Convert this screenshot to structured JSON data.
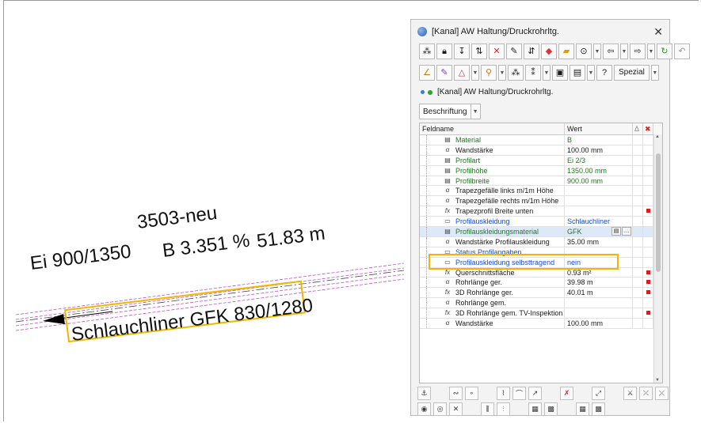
{
  "cad": {
    "name": "3503-neu",
    "dims": "Ei 900/1350",
    "slope": "B 3.351 %",
    "length": "51.83 m",
    "liner": "Schlauchliner GFK 830/1280",
    "highlight_color": "#f5b400",
    "hatch_color": "#c050c0"
  },
  "dialog": {
    "title": "[Kanal] AW Haltung/Druckrohrltg.",
    "close": "✕",
    "layer": "[Kanal] AW Haltung/Druckrohrltg.",
    "beschriftung": "Beschriftung",
    "spezial": "Spezial",
    "columns": {
      "name": "Feldname",
      "value": "Wert",
      "delta": "Δ",
      "x": "✖"
    },
    "rows": [
      {
        "icon": "book-icon",
        "glyph": "▤",
        "name": "Material",
        "value": "B",
        "style": "green",
        "red": false
      },
      {
        "icon": "alpha-icon",
        "glyph": "α",
        "name": "Wandstärke",
        "value": "100.00 mm",
        "style": "",
        "red": false
      },
      {
        "icon": "book-icon",
        "glyph": "▤",
        "name": "Profilart",
        "value": "Ei 2/3",
        "style": "green",
        "red": false
      },
      {
        "icon": "book-icon",
        "glyph": "▤",
        "name": "Profilhöhe",
        "value": "1350.00 mm",
        "style": "green",
        "red": false
      },
      {
        "icon": "book-icon",
        "glyph": "▤",
        "name": "Profilbreite",
        "value": "900.00 mm",
        "style": "green",
        "red": false
      },
      {
        "icon": "alpha-icon",
        "glyph": "α",
        "name": "Trapezgefälle links m/1m Höhe",
        "value": "",
        "style": "",
        "red": false
      },
      {
        "icon": "alpha-icon",
        "glyph": "α",
        "name": "Trapezgefälle rechts m/1m Höhe",
        "value": "",
        "style": "",
        "red": false
      },
      {
        "icon": "fx-icon",
        "glyph": "fx",
        "name": "Trapezprofil Breite unten",
        "value": "",
        "style": "",
        "red": true
      },
      {
        "icon": "list-icon",
        "glyph": "▭",
        "name": "Profilauskleidung",
        "value": "Schlauchliner",
        "style": "blue",
        "red": false
      },
      {
        "icon": "book-icon",
        "glyph": "▤",
        "name": "Profilauskleidungsmaterial",
        "value": "GFK",
        "style": "green",
        "red": false,
        "selected": true
      },
      {
        "icon": "alpha-icon",
        "glyph": "α",
        "name": "Wandstärke Profilauskleidung",
        "value": "35.00 mm",
        "style": "",
        "red": false
      },
      {
        "icon": "list-icon",
        "glyph": "▭",
        "name": "Status Profilangaben",
        "value": "",
        "style": "blue",
        "red": false
      },
      {
        "icon": "list-icon",
        "glyph": "▭",
        "name": "Profilauskleidung selbsttragend",
        "value": "nein",
        "style": "blue",
        "red": false
      },
      {
        "icon": "fx-icon",
        "glyph": "fx",
        "name": "Querschnittsfläche",
        "value": "0.93 m²",
        "style": "",
        "red": true
      },
      {
        "icon": "alpha-icon",
        "glyph": "α",
        "name": "Rohrlänge ger.",
        "value": "39.98 m",
        "style": "",
        "red": true
      },
      {
        "icon": "fx-icon",
        "glyph": "fx",
        "name": "3D Rohrlänge ger.",
        "value": "40.01 m",
        "style": "",
        "red": true
      },
      {
        "icon": "alpha-icon",
        "glyph": "α",
        "name": "Rohrlänge gem.",
        "value": "",
        "style": "",
        "red": false
      },
      {
        "icon": "fx-icon",
        "glyph": "fx",
        "name": "3D Rohrlänge gem. TV-Inspektion",
        "value": "",
        "style": "",
        "red": true
      },
      {
        "icon": "alpha-icon",
        "glyph": "α",
        "name": "Wandstärke",
        "value": "100.00 mm",
        "style": "",
        "red": false
      }
    ]
  }
}
